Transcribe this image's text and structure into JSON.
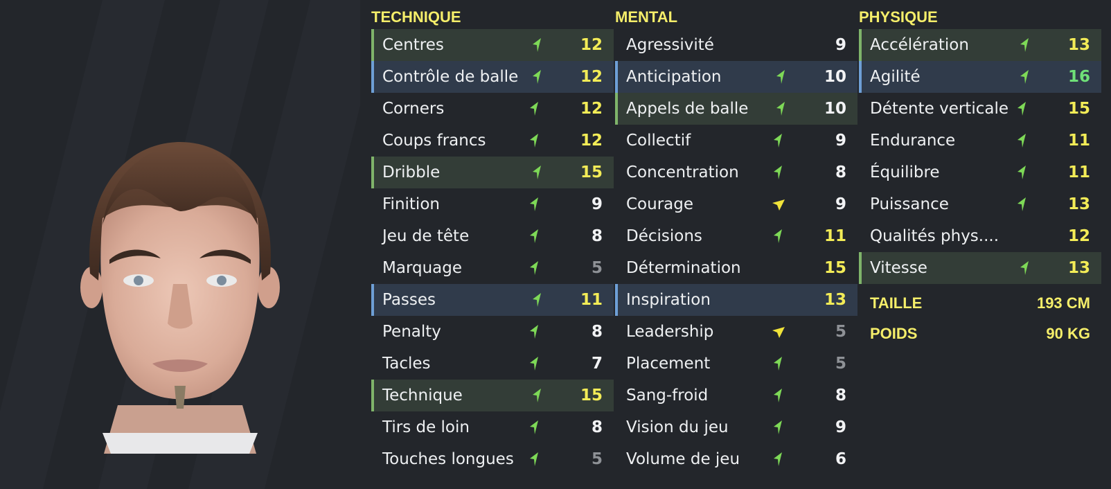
{
  "colors": {
    "background": "#23262b",
    "header": "#f5ee6a",
    "highlight_green": "#333d37",
    "highlight_blue": "#303b4b",
    "arrow_up": "#7ed957",
    "arrow_flat": "#f0e33a"
  },
  "portrait": {
    "icon": "player-face-portrait"
  },
  "technique": {
    "title": "TECHNIQUE",
    "rows": [
      {
        "label": "Centres",
        "value": "12",
        "tone": "yellow",
        "hl": "green",
        "arrow": "up"
      },
      {
        "label": "Contrôle de balle",
        "value": "12",
        "tone": "yellow",
        "hl": "blue",
        "arrow": "up"
      },
      {
        "label": "Corners",
        "value": "12",
        "tone": "yellow",
        "hl": "",
        "arrow": "up"
      },
      {
        "label": "Coups francs",
        "value": "12",
        "tone": "yellow",
        "hl": "",
        "arrow": "up"
      },
      {
        "label": "Dribble",
        "value": "15",
        "tone": "yellow",
        "hl": "green",
        "arrow": "up"
      },
      {
        "label": "Finition",
        "value": "9",
        "tone": "white",
        "hl": "",
        "arrow": "up"
      },
      {
        "label": "Jeu de tête",
        "value": "8",
        "tone": "white",
        "hl": "",
        "arrow": "up"
      },
      {
        "label": "Marquage",
        "value": "5",
        "tone": "grey",
        "hl": "",
        "arrow": "up"
      },
      {
        "label": "Passes",
        "value": "11",
        "tone": "yellow",
        "hl": "blue",
        "arrow": "up"
      },
      {
        "label": "Penalty",
        "value": "8",
        "tone": "white",
        "hl": "",
        "arrow": "up"
      },
      {
        "label": "Tacles",
        "value": "7",
        "tone": "white",
        "hl": "",
        "arrow": "up"
      },
      {
        "label": "Technique",
        "value": "15",
        "tone": "yellow",
        "hl": "green",
        "arrow": "up"
      },
      {
        "label": "Tirs de loin",
        "value": "8",
        "tone": "white",
        "hl": "",
        "arrow": "up"
      },
      {
        "label": "Touches longues",
        "value": "5",
        "tone": "grey",
        "hl": "",
        "arrow": "up"
      }
    ]
  },
  "mental": {
    "title": "MENTAL",
    "rows": [
      {
        "label": "Agressivité",
        "value": "9",
        "tone": "white",
        "hl": "",
        "arrow": ""
      },
      {
        "label": "Anticipation",
        "value": "10",
        "tone": "white",
        "hl": "blue",
        "arrow": "up"
      },
      {
        "label": "Appels de balle",
        "value": "10",
        "tone": "white",
        "hl": "green",
        "arrow": "up"
      },
      {
        "label": "Collectif",
        "value": "9",
        "tone": "white",
        "hl": "",
        "arrow": "up"
      },
      {
        "label": "Concentration",
        "value": "8",
        "tone": "white",
        "hl": "",
        "arrow": "up"
      },
      {
        "label": "Courage",
        "value": "9",
        "tone": "white",
        "hl": "",
        "arrow": "flat"
      },
      {
        "label": "Décisions",
        "value": "11",
        "tone": "yellow",
        "hl": "",
        "arrow": "up"
      },
      {
        "label": "Détermination",
        "value": "15",
        "tone": "yellow",
        "hl": "",
        "arrow": ""
      },
      {
        "label": "Inspiration",
        "value": "13",
        "tone": "yellow",
        "hl": "blue",
        "arrow": ""
      },
      {
        "label": "Leadership",
        "value": "5",
        "tone": "grey",
        "hl": "",
        "arrow": "flat"
      },
      {
        "label": "Placement",
        "value": "5",
        "tone": "grey",
        "hl": "",
        "arrow": "up"
      },
      {
        "label": "Sang-froid",
        "value": "8",
        "tone": "white",
        "hl": "",
        "arrow": "up"
      },
      {
        "label": "Vision du jeu",
        "value": "9",
        "tone": "white",
        "hl": "",
        "arrow": "up"
      },
      {
        "label": "Volume de jeu",
        "value": "6",
        "tone": "white",
        "hl": "",
        "arrow": "up"
      }
    ]
  },
  "physique": {
    "title": "PHYSIQUE",
    "rows": [
      {
        "label": "Accélération",
        "value": "13",
        "tone": "yellow",
        "hl": "green",
        "arrow": "up"
      },
      {
        "label": "Agilité",
        "value": "16",
        "tone": "green",
        "hl": "blue",
        "arrow": "up"
      },
      {
        "label": "Détente verticale",
        "value": "15",
        "tone": "yellow",
        "hl": "",
        "arrow": "up"
      },
      {
        "label": "Endurance",
        "value": "11",
        "tone": "yellow",
        "hl": "",
        "arrow": "up"
      },
      {
        "label": "Équilibre",
        "value": "11",
        "tone": "yellow",
        "hl": "",
        "arrow": "up"
      },
      {
        "label": "Puissance",
        "value": "13",
        "tone": "yellow",
        "hl": "",
        "arrow": "up"
      },
      {
        "label": "Qualités phys....",
        "value": "12",
        "tone": "yellow",
        "hl": "",
        "arrow": ""
      },
      {
        "label": "Vitesse",
        "value": "13",
        "tone": "yellow",
        "hl": "green",
        "arrow": "up"
      }
    ],
    "info": [
      {
        "key": "TAILLE",
        "value": "193 CM"
      },
      {
        "key": "POIDS",
        "value": "90 KG"
      }
    ]
  }
}
